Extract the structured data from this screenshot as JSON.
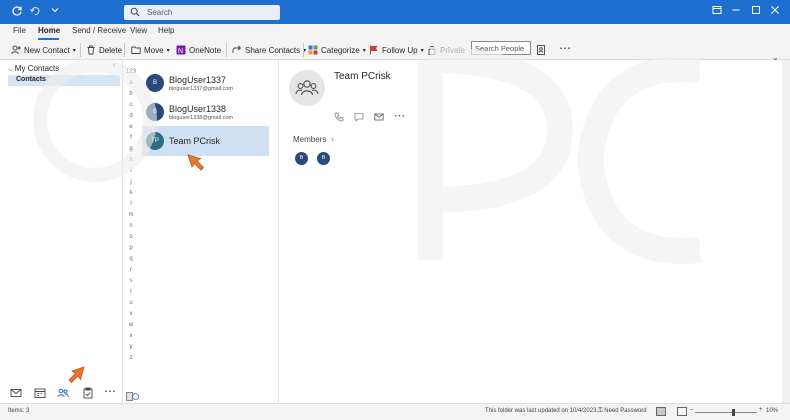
{
  "titlebar": {
    "search_placeholder": "Search",
    "icons": [
      "refresh-icon",
      "undo-icon",
      "dropdown-icon"
    ],
    "accent": "#1f6fd0"
  },
  "menu": {
    "tabs": [
      "File",
      "Home",
      "Send / Receive",
      "View",
      "Help"
    ],
    "active": "Home"
  },
  "ribbon": {
    "new_contact": "New Contact",
    "delete": "Delete",
    "move": "Move",
    "onenote": "OneNote",
    "share_contacts": "Share Contacts",
    "categorize": "Categorize",
    "follow_up": "Follow Up",
    "private": "Private",
    "search_people": "Search People"
  },
  "nav": {
    "section": "My Contacts",
    "folder": "Contacts"
  },
  "alphabet": [
    "123",
    "a",
    "b",
    "c",
    "d",
    "e",
    "f",
    "g",
    "h",
    "i",
    "j",
    "k",
    "l",
    "m",
    "n",
    "o",
    "p",
    "q",
    "r",
    "s",
    "t",
    "u",
    "v",
    "w",
    "x",
    "y",
    "z"
  ],
  "contacts": [
    {
      "initials": "B",
      "name": "BlogUser1337",
      "email": "bloguser1337@gmail.com"
    },
    {
      "initials": "B",
      "name": "BlogUser1338",
      "email": "bloguser1338@gmail.com"
    },
    {
      "initials": "TP",
      "name": "Team PCrisk",
      "email": ""
    }
  ],
  "reading": {
    "name": "Team PCrisk",
    "members_label": "Members",
    "members": [
      {
        "initials": "B"
      },
      {
        "initials": "B"
      }
    ]
  },
  "status": {
    "items": "Items: 3",
    "updated": "This folder was last updated on 10/4/2023.",
    "need_password": "Need Password",
    "zoom": "10%"
  }
}
